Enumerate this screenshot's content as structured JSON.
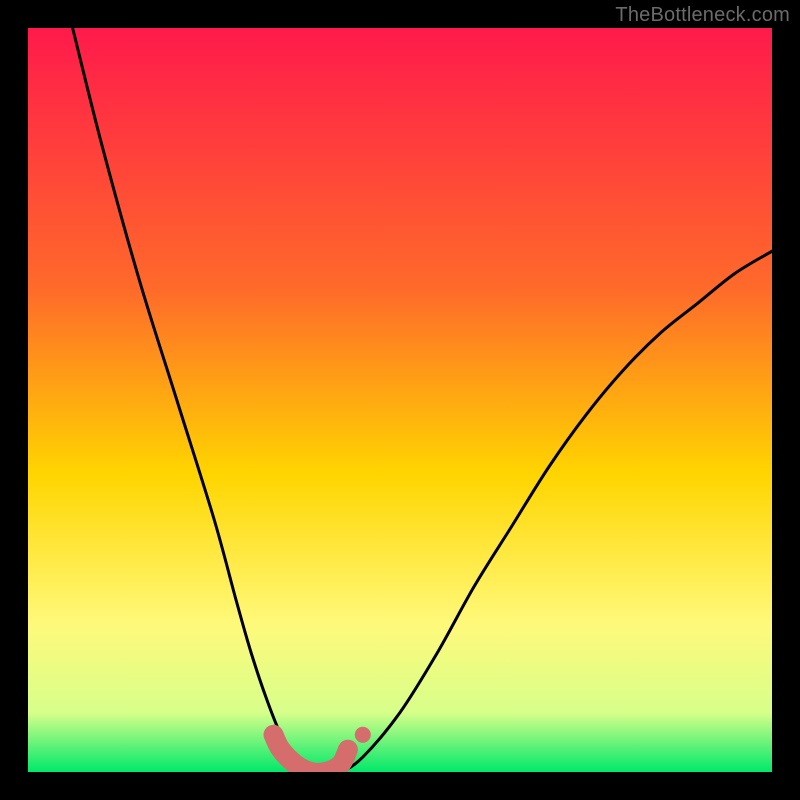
{
  "attribution": "TheBottleneck.com",
  "colors": {
    "gradient_top": "#ff1a4b",
    "gradient_mid1": "#ff6a2a",
    "gradient_mid2": "#ffd500",
    "gradient_mid3": "#fff97a",
    "gradient_mid4": "#d7ff8a",
    "gradient_bottom": "#00e86b",
    "curve": "#000000",
    "marker_fill": "#d66d6d",
    "marker_stroke": "#d66d6d",
    "frame": "#000000",
    "text": "#6b6b6b"
  },
  "chart_data": {
    "type": "line",
    "title": "",
    "xlabel": "",
    "ylabel": "",
    "xlim": [
      0,
      100
    ],
    "ylim": [
      0,
      100
    ],
    "legend": false,
    "grid": false,
    "annotations": [],
    "series": [
      {
        "name": "bottleneck-curve",
        "style": "line",
        "x": [
          6,
          10,
          15,
          20,
          25,
          28,
          30,
          32,
          34,
          36,
          38,
          40,
          42,
          45,
          50,
          55,
          60,
          65,
          70,
          75,
          80,
          85,
          90,
          95,
          100
        ],
        "values": [
          100,
          84,
          66,
          50,
          34,
          23,
          16,
          10,
          5,
          2,
          0,
          0,
          0,
          2,
          8,
          16,
          25,
          33,
          41,
          48,
          54,
          59,
          63,
          67,
          70
        ]
      },
      {
        "name": "highlight-band",
        "style": "thick-line",
        "x": [
          33,
          34,
          36,
          38,
          40,
          42,
          43
        ],
        "values": [
          5,
          3,
          1,
          0,
          0,
          1,
          3
        ]
      },
      {
        "name": "highlight-dot",
        "style": "point",
        "x": [
          45
        ],
        "values": [
          5
        ]
      }
    ]
  }
}
